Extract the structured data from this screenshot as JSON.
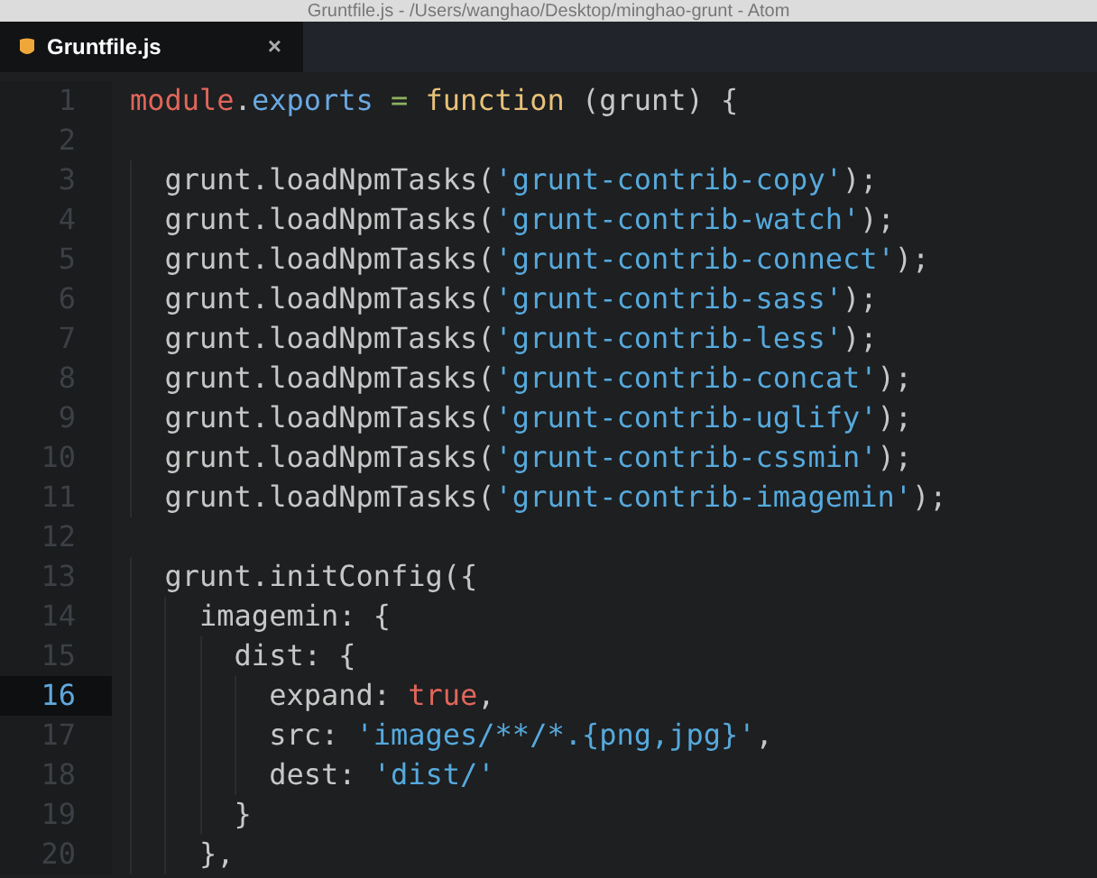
{
  "window": {
    "title": "Gruntfile.js - /Users/wanghao/Desktop/minghao-grunt - Atom"
  },
  "tabs": [
    {
      "label": "Gruntfile.js",
      "close": "×",
      "selected": true
    }
  ],
  "editor": {
    "lines": [
      {
        "number": "1",
        "selected": false,
        "tokens": [
          {
            "text": "module",
            "kind": "variable"
          },
          {
            "text": ".",
            "kind": "plain"
          },
          {
            "text": "exports ",
            "kind": "property"
          },
          {
            "text": "= ",
            "kind": "operator"
          },
          {
            "text": "function",
            "kind": "keyword"
          },
          {
            "text": " (grunt) {",
            "kind": "plain"
          }
        ]
      },
      {
        "number": "2",
        "selected": false
      },
      {
        "number": "3",
        "selected": false,
        "tokens": [
          {
            "text": "  grunt.loadNpmTasks(",
            "kind": "plain"
          },
          {
            "text": "'grunt-contrib-copy'",
            "kind": "string"
          },
          {
            "text": ");",
            "kind": "plain"
          }
        ]
      },
      {
        "number": "4",
        "selected": false,
        "tokens": [
          {
            "text": "  grunt.loadNpmTasks(",
            "kind": "plain"
          },
          {
            "text": "'grunt-contrib-watch'",
            "kind": "string"
          },
          {
            "text": ");",
            "kind": "plain"
          }
        ]
      },
      {
        "number": "5",
        "selected": false,
        "tokens": [
          {
            "text": "  grunt.loadNpmTasks(",
            "kind": "plain"
          },
          {
            "text": "'grunt-contrib-connect'",
            "kind": "string"
          },
          {
            "text": ");",
            "kind": "plain"
          }
        ]
      },
      {
        "number": "6",
        "selected": false,
        "tokens": [
          {
            "text": "  grunt.loadNpmTasks(",
            "kind": "plain"
          },
          {
            "text": "'grunt-contrib-sass'",
            "kind": "string"
          },
          {
            "text": ");",
            "kind": "plain"
          }
        ]
      },
      {
        "number": "7",
        "selected": false,
        "tokens": [
          {
            "text": "  grunt.loadNpmTasks(",
            "kind": "plain"
          },
          {
            "text": "'grunt-contrib-less'",
            "kind": "string"
          },
          {
            "text": ");",
            "kind": "plain"
          }
        ]
      },
      {
        "number": "8",
        "selected": false,
        "tokens": [
          {
            "text": "  grunt.loadNpmTasks(",
            "kind": "plain"
          },
          {
            "text": "'grunt-contrib-concat'",
            "kind": "string"
          },
          {
            "text": ");",
            "kind": "plain"
          }
        ]
      },
      {
        "number": "9",
        "selected": false,
        "tokens": [
          {
            "text": "  grunt.loadNpmTasks(",
            "kind": "plain"
          },
          {
            "text": "'grunt-contrib-uglify'",
            "kind": "string"
          },
          {
            "text": ");",
            "kind": "plain"
          }
        ]
      },
      {
        "number": "10",
        "selected": false,
        "tokens": [
          {
            "text": "  grunt.loadNpmTasks(",
            "kind": "plain"
          },
          {
            "text": "'grunt-contrib-cssmin'",
            "kind": "string"
          },
          {
            "text": ");",
            "kind": "plain"
          }
        ]
      },
      {
        "number": "11",
        "selected": false,
        "tokens": [
          {
            "text": "  grunt.loadNpmTasks(",
            "kind": "plain"
          },
          {
            "text": "'grunt-contrib-imagemin'",
            "kind": "string"
          },
          {
            "text": ");",
            "kind": "plain"
          }
        ]
      },
      {
        "number": "12",
        "selected": false
      },
      {
        "number": "13",
        "selected": false,
        "tokens": [
          {
            "text": "  grunt.initConfig({",
            "kind": "plain"
          }
        ]
      },
      {
        "number": "14",
        "selected": false,
        "tokens": [
          {
            "text": "    imagemin: {",
            "kind": "plain"
          }
        ]
      },
      {
        "number": "15",
        "selected": false,
        "tokens": [
          {
            "text": "      dist: {",
            "kind": "plain"
          }
        ]
      },
      {
        "number": "16",
        "selected": true,
        "tokens": [
          {
            "text": "        expand: ",
            "kind": "plain"
          },
          {
            "text": "true",
            "kind": "variable"
          },
          {
            "text": ",",
            "kind": "plain"
          }
        ]
      },
      {
        "number": "17",
        "selected": false,
        "tokens": [
          {
            "text": "        src: ",
            "kind": "plain"
          },
          {
            "text": "'images/**/*.{png,jpg}'",
            "kind": "string"
          },
          {
            "text": ",",
            "kind": "plain"
          }
        ]
      },
      {
        "number": "18",
        "selected": false,
        "tokens": [
          {
            "text": "        dest: ",
            "kind": "plain"
          },
          {
            "text": "'dist/'",
            "kind": "string"
          }
        ]
      },
      {
        "number": "19",
        "selected": false,
        "tokens": [
          {
            "text": "      }",
            "kind": "plain"
          }
        ]
      },
      {
        "number": "20",
        "selected": false,
        "tokens": [
          {
            "text": "    },",
            "kind": "plain"
          }
        ]
      }
    ]
  }
}
